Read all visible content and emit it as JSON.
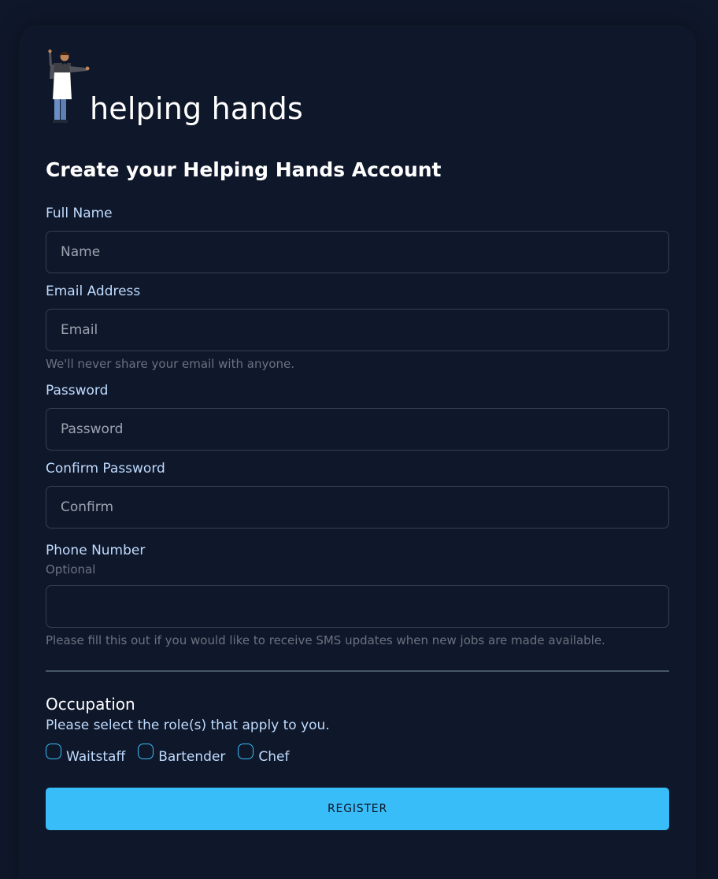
{
  "logo": {
    "text": "helping hands",
    "illustration": "waiter-icon"
  },
  "form": {
    "title": "Create your Helping Hands Account",
    "full_name": {
      "label": "Full Name",
      "placeholder": "Name",
      "value": ""
    },
    "email": {
      "label": "Email Address",
      "placeholder": "Email",
      "value": "",
      "help": "We'll never share your email with anyone."
    },
    "password": {
      "label": "Password",
      "placeholder": "Password",
      "value": ""
    },
    "confirm_password": {
      "label": "Confirm Password",
      "placeholder": "Confirm",
      "value": ""
    },
    "phone": {
      "label": "Phone Number",
      "sublabel": "Optional",
      "placeholder": "",
      "value": "",
      "help": "Please fill this out if you would like to receive SMS updates when new jobs are made available."
    },
    "occupation": {
      "title": "Occupation",
      "subtitle": "Please select the role(s) that apply to you.",
      "options": [
        {
          "label": "Waitstaff",
          "checked": false
        },
        {
          "label": "Bartender",
          "checked": false
        },
        {
          "label": "Chef",
          "checked": false
        }
      ]
    },
    "register_label": "REGISTER"
  },
  "colors": {
    "background": "#0f172a",
    "accent": "#38bdf8",
    "label": "#bfdbfe",
    "muted": "#6b7280",
    "border": "#334155"
  }
}
